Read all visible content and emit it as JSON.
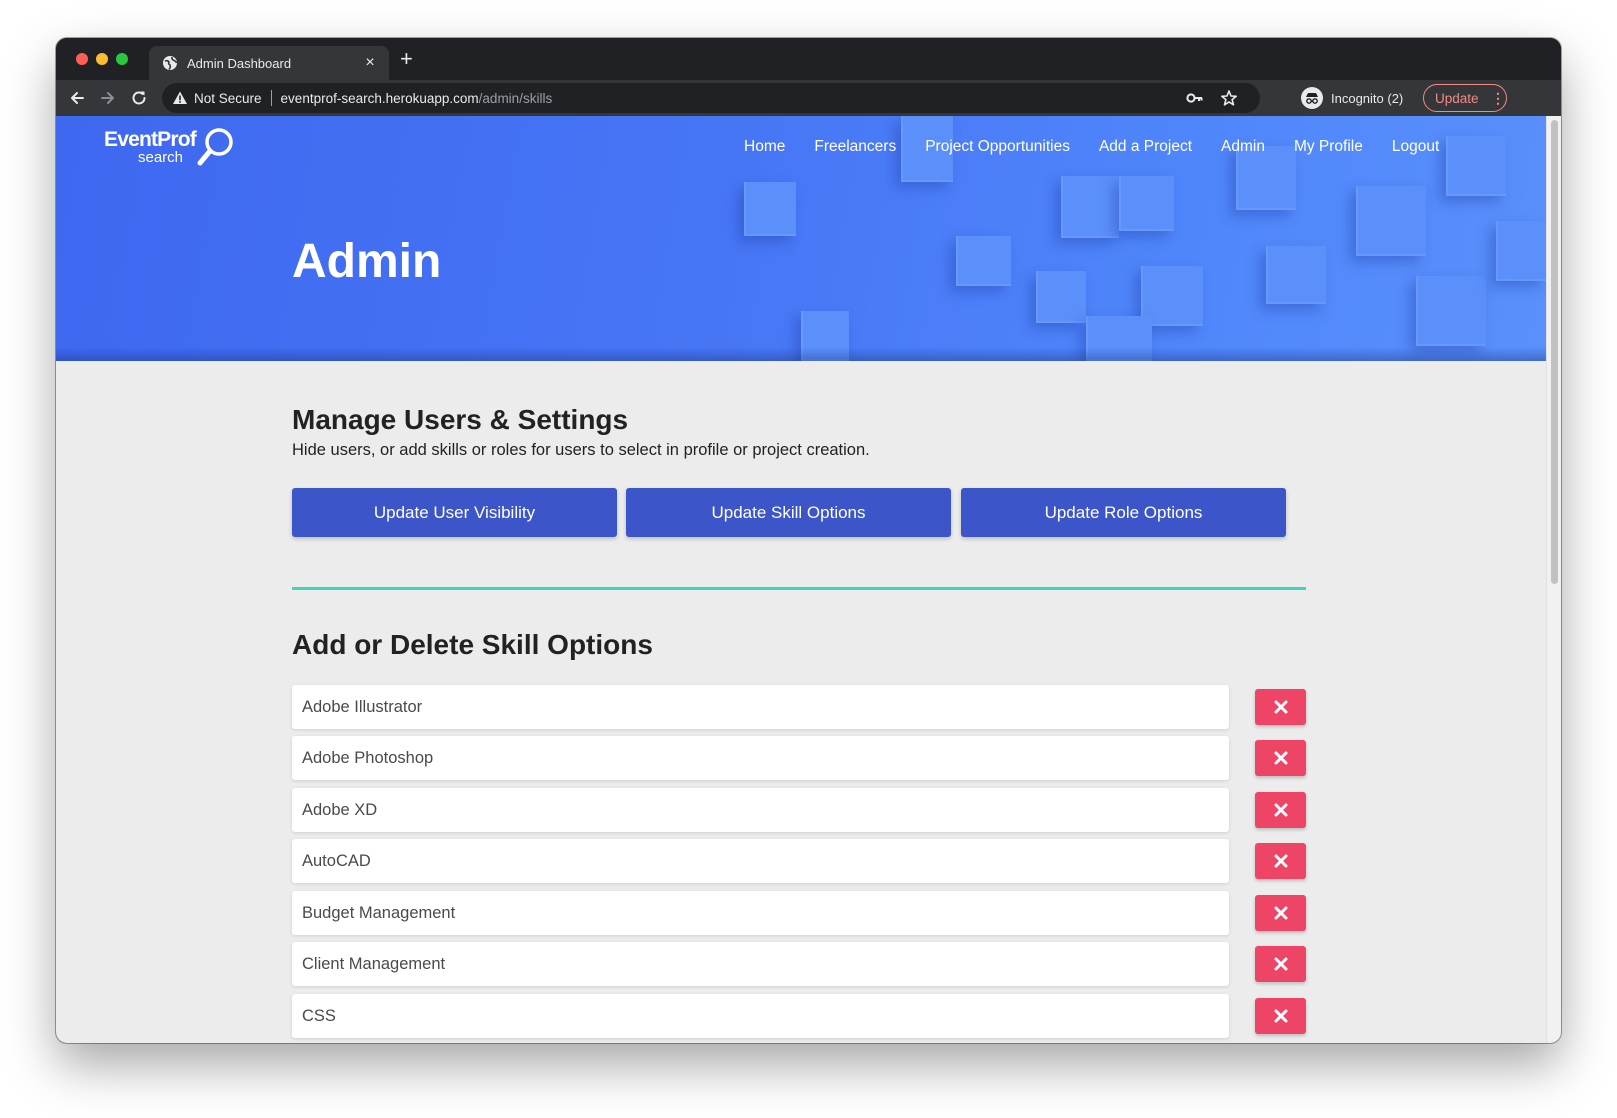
{
  "browser": {
    "tab_title": "Admin Dashboard",
    "new_tab_symbol": "+",
    "close_tab_symbol": "×",
    "security_label": "Not Secure",
    "url_host": "eventprof-search.herokuapp.com",
    "url_path": "/admin/skills",
    "incognito_label": "Incognito (2)",
    "update_label": "Update",
    "menu_symbol": "⋮"
  },
  "site": {
    "logo_main": "EventProf",
    "logo_sub": "search",
    "nav": [
      "Home",
      "Freelancers",
      "Project Opportunities",
      "Add a Project",
      "Admin",
      "My Profile",
      "Logout"
    ],
    "hero_title": "Admin"
  },
  "manage": {
    "title": "Manage Users & Settings",
    "description": "Hide users, or add skills or roles for users to select in profile or project creation.",
    "buttons": [
      "Update User Visibility",
      "Update Skill Options",
      "Update Role Options"
    ]
  },
  "skills": {
    "title": "Add or Delete Skill Options",
    "items": [
      "Adobe Illustrator",
      "Adobe Photoshop",
      "Adobe XD",
      "AutoCAD",
      "Budget Management",
      "Client Management",
      "CSS"
    ]
  },
  "colors": {
    "hero_blue": "#4776f5",
    "primary_button": "#3c55c9",
    "divider_teal": "#3ed5bf",
    "delete_red": "#ee4466",
    "update_pill": "#f28b82"
  },
  "icons": [
    "globe-icon",
    "back-arrow-icon",
    "forward-arrow-icon",
    "reload-icon",
    "warning-icon",
    "key-icon",
    "star-icon",
    "incognito-icon",
    "search-magnifier-icon",
    "close-x-icon"
  ]
}
